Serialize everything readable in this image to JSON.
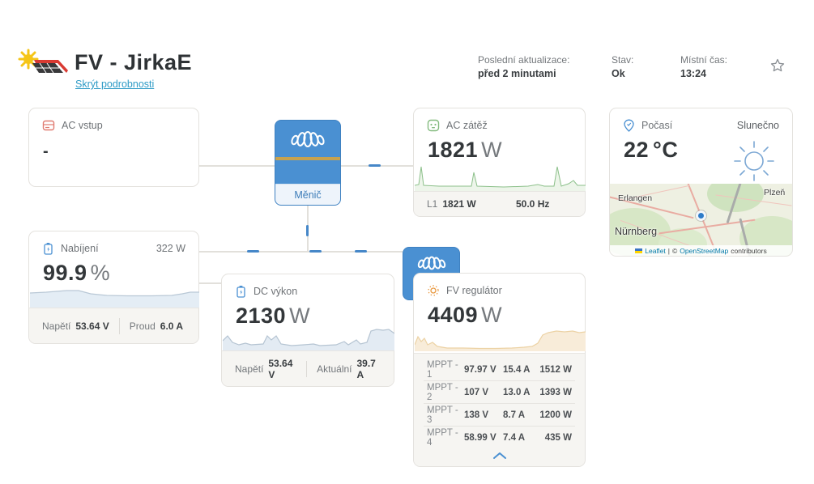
{
  "header": {
    "title": "FV - JirkaE",
    "toggle_link": "Skrýt podrobnosti",
    "last_update_label": "Poslední aktualizace:",
    "last_update_value": "před 2 minutami",
    "status_label": "Stav:",
    "status_value": "Ok",
    "local_time_label": "Místní čas:",
    "local_time_value": "13:24"
  },
  "icons": {
    "logo": "solar-roof-sun-logo",
    "favorite": "star-outline-icon",
    "ac_input": "grid-box-icon",
    "ac_loads": "outlet-icon",
    "battery": "battery-charge-icon",
    "dc_power": "battery-icon",
    "solar": "sun-icon",
    "weather_pin": "location-pin-icon",
    "weather_condition": "sun-outline-icon",
    "inverter_logo": "victron-coil-logo",
    "collapse": "chevron-up-icon"
  },
  "cards": {
    "ac_input": {
      "title": "AC vstup",
      "value": "-"
    },
    "inverter": {
      "label": "Měnič"
    },
    "ac_loads": {
      "title": "AC zátěž",
      "value": "1821",
      "unit": "W",
      "l1_label": "L1",
      "l1_value": "1821 W",
      "frequency": "50.0 Hz"
    },
    "weather": {
      "title": "Počasí",
      "condition": "Slunečno",
      "temp_value": "22",
      "temp_unit": "°C",
      "map": {
        "cities": [
          "Erlangen",
          "Nürnberg",
          "Plzeň"
        ],
        "attribution_leaflet": "Leaflet",
        "attribution_sep": "|",
        "attribution_osm_prefix": "©",
        "attribution_osm_link": "OpenStreetMap",
        "attribution_osm_suffix": "contributors"
      }
    },
    "battery": {
      "title": "Nabíjení",
      "power": "322 W",
      "value": "99.9",
      "unit": "%",
      "voltage_label": "Napětí",
      "voltage_value": "53.64 V",
      "current_label": "Proud",
      "current_value": "6.0 A"
    },
    "dc_power": {
      "title": "DC výkon",
      "value": "2130",
      "unit": "W",
      "voltage_label": "Napětí",
      "voltage_value": "53.64 V",
      "current_label": "Aktuální",
      "current_value": "39.7 A"
    },
    "solar": {
      "title": "FV regulátor",
      "value": "4409",
      "unit": "W",
      "rows": [
        {
          "label": "MPPT - 1",
          "voltage": "97.97 V",
          "current": "15.4 A",
          "power": "1512 W"
        },
        {
          "label": "MPPT - 2",
          "voltage": "107 V",
          "current": "13.0 A",
          "power": "1393 W"
        },
        {
          "label": "MPPT - 3",
          "voltage": "138 V",
          "current": "8.7 A",
          "power": "1200 W"
        },
        {
          "label": "MPPT - 4",
          "voltage": "58.99 V",
          "current": "7.4 A",
          "power": "435 W"
        }
      ]
    }
  },
  "colors": {
    "accent_blue": "#4a90d2",
    "link_blue": "#2e9bc6",
    "gold_stripe": "#c7a24f",
    "green": "#84bb7f",
    "orange": "#e8973d",
    "card_border": "#e4e2de",
    "footer_bg": "#f6f5f2"
  }
}
